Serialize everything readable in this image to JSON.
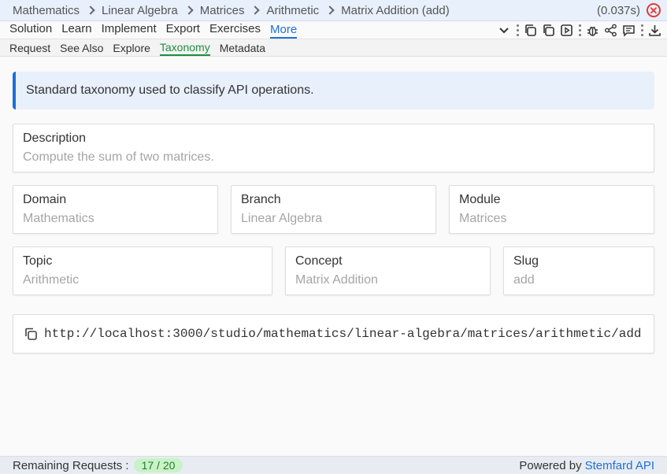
{
  "breadcrumb": {
    "items": [
      "Mathematics",
      "Linear Algebra",
      "Matrices",
      "Arithmetic",
      "Matrix Addition (add)"
    ],
    "timing": "(0.037s)"
  },
  "menu": {
    "items": [
      "Solution",
      "Learn",
      "Implement",
      "Export",
      "Exercises",
      "More"
    ],
    "active": "More"
  },
  "toolbar_icons": [
    "chevron-down-icon",
    "kebab-icon",
    "copy-icon",
    "duplicate-icon",
    "play-icon",
    "kebab-icon",
    "bug-icon",
    "share-icon",
    "comment-icon",
    "kebab-icon",
    "download-icon"
  ],
  "subtabs": {
    "items": [
      "Request",
      "See Also",
      "Explore",
      "Taxonomy",
      "Metadata"
    ],
    "active": "Taxonomy"
  },
  "info": {
    "text": "Standard taxonomy used to classify API operations."
  },
  "taxonomy": {
    "description": {
      "label": "Description",
      "value": "Compute the sum of two matrices."
    },
    "domain": {
      "label": "Domain",
      "value": "Mathematics"
    },
    "branch": {
      "label": "Branch",
      "value": "Linear Algebra"
    },
    "module": {
      "label": "Module",
      "value": "Matrices"
    },
    "topic": {
      "label": "Topic",
      "value": "Arithmetic"
    },
    "concept": {
      "label": "Concept",
      "value": "Matrix Addition"
    },
    "slug": {
      "label": "Slug",
      "value": "add"
    }
  },
  "url": {
    "value": "http://localhost:3000/studio/mathematics/linear-algebra/matrices/arithmetic/add"
  },
  "footer": {
    "remaining_label": "Remaining Requests :",
    "remaining_value": "17 / 20",
    "powered_by": "Powered by",
    "brand": "Stemfard API"
  },
  "colors": {
    "accent": "#1e6fd9",
    "active_subtab": "#1e8e3e",
    "close": "#e53935",
    "badge_bg": "#c8f2c8"
  }
}
